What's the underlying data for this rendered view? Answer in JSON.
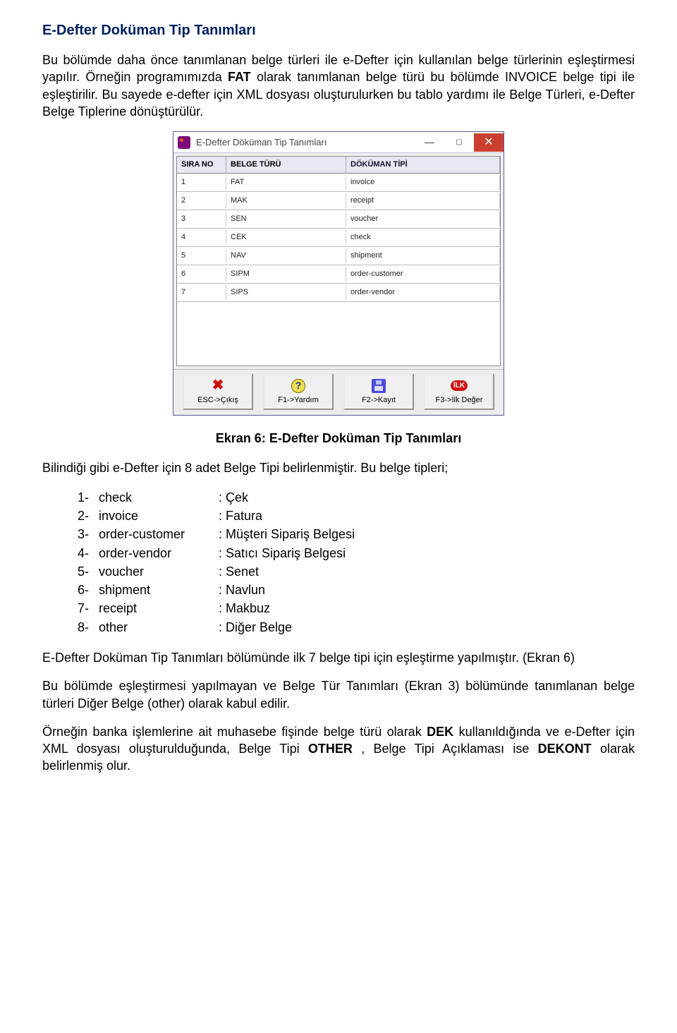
{
  "doc": {
    "title": "E-Defter Doküman Tip Tanımları",
    "p1a": "Bu bölümde daha önce tanımlanan belge türleri ile e-Defter için kullanılan belge türlerinin eşleştirmesi yapılır. Örneğin programımızda ",
    "p1b": "FAT",
    "p1c": " olarak tanımlanan belge türü bu bölümde INVOICE belge tipi ile eşleştirilir. Bu sayede e-defter için XML dosyası oluşturulurken bu tablo yardımı ile Belge Türleri, e-Defter Belge Tiplerine dönüştürülür.",
    "caption": "Ekran 6: E-Defter Doküman Tip Tanımları",
    "p2": "Bilindiği gibi e-Defter için 8 adet Belge Tipi belirlenmiştir. Bu belge tipleri;",
    "p3": "E-Defter Doküman Tip Tanımları bölümünde ilk 7 belge tipi için eşleştirme yapılmıştır. (Ekran 6)",
    "p4": "Bu bölümde eşleştirmesi yapılmayan ve Belge Tür Tanımları (Ekran 3) bölümünde tanımlanan belge türleri Diğer Belge (other) olarak kabul edilir.",
    "p5a": "Örneğin banka işlemlerine ait muhasebe fişinde belge türü olarak ",
    "p5b": "DEK",
    "p5c": " kullanıldığında ve e-Defter için XML dosyası oluşturulduğunda, Belge Tipi ",
    "p5d": "OTHER",
    "p5e": ", Belge Tipi Açıklaması ise ",
    "p5f": "DEKONT",
    "p5g": " olarak belirlenmiş olur."
  },
  "dialog": {
    "title": "E-Defter Döküman Tip Tanımları",
    "headers": {
      "c1": "SIRA NO",
      "c2": "BELGE TÜRÜ",
      "c3": "DÖKÜMAN TİPİ"
    },
    "rows": [
      {
        "no": "1",
        "turu": "FAT",
        "tipi": "invoice"
      },
      {
        "no": "2",
        "turu": "MAK",
        "tipi": "receipt"
      },
      {
        "no": "3",
        "turu": "SEN",
        "tipi": "voucher"
      },
      {
        "no": "4",
        "turu": "CEK",
        "tipi": "check"
      },
      {
        "no": "5",
        "turu": "NAV",
        "tipi": "shipment"
      },
      {
        "no": "6",
        "turu": "SIPM",
        "tipi": "order-customer"
      },
      {
        "no": "7",
        "turu": "SIPS",
        "tipi": "order-vendor"
      }
    ],
    "toolbar": {
      "esc": "ESC->Çıkış",
      "f1": "F1->Yardım",
      "f2": "F2->Kayıt",
      "f3": "F3->İlk Değer",
      "ilk": "İLK"
    }
  },
  "type_list": [
    {
      "n": "1-",
      "code": "check",
      "desc": ": Çek"
    },
    {
      "n": "2-",
      "code": "invoice",
      "desc": ": Fatura"
    },
    {
      "n": "3-",
      "code": "order-customer",
      "desc": ": Müşteri Sipariş Belgesi"
    },
    {
      "n": "4-",
      "code": "order-vendor",
      "desc": ": Satıcı Sipariş Belgesi"
    },
    {
      "n": "5-",
      "code": "voucher",
      "desc": ": Senet"
    },
    {
      "n": "6-",
      "code": "shipment",
      "desc": ": Navlun"
    },
    {
      "n": "7-",
      "code": "receipt",
      "desc": ": Makbuz"
    },
    {
      "n": "8-",
      "code": "other",
      "desc": ": Diğer Belge"
    }
  ]
}
